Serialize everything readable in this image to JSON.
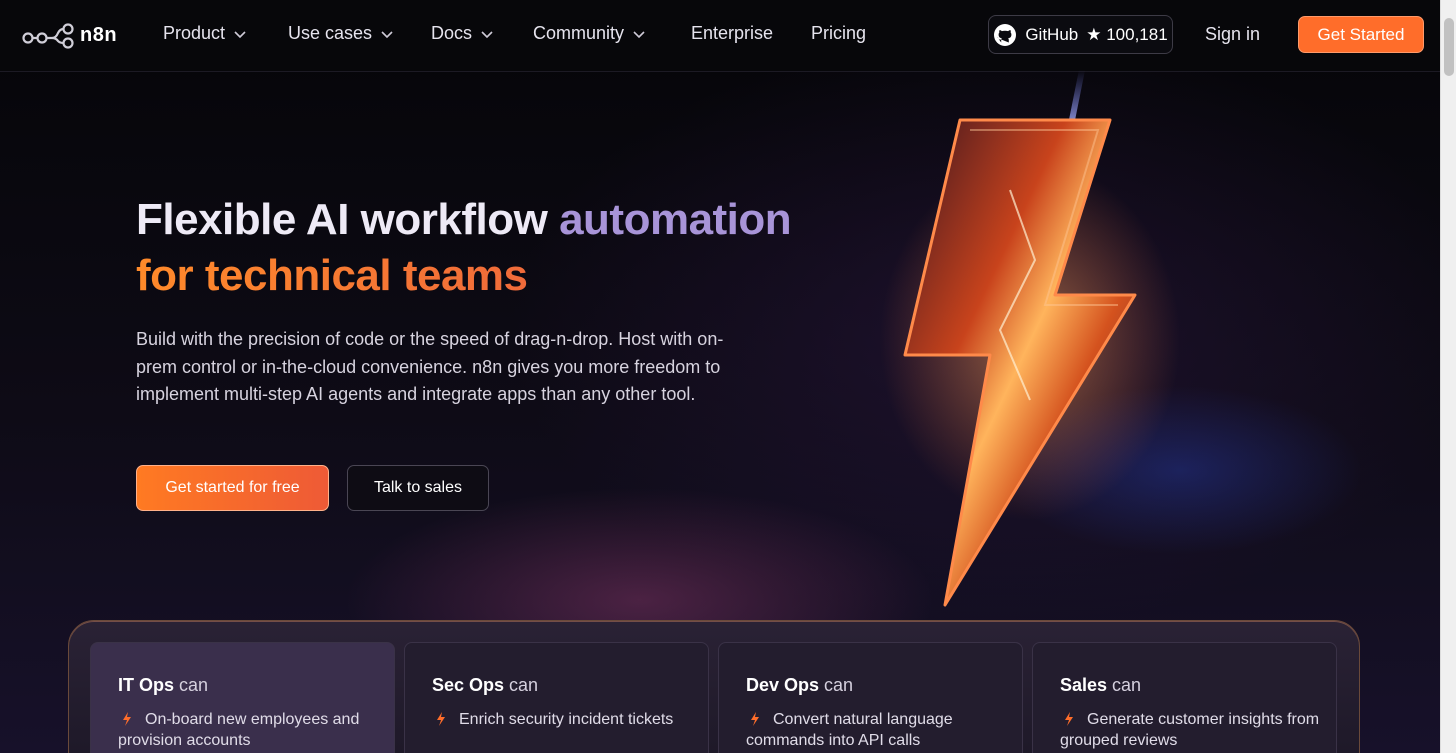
{
  "nav": {
    "logo_text": "n8n",
    "items": [
      {
        "label": "Product",
        "has_dropdown": true
      },
      {
        "label": "Use cases",
        "has_dropdown": true
      },
      {
        "label": "Docs",
        "has_dropdown": true
      },
      {
        "label": "Community",
        "has_dropdown": true
      },
      {
        "label": "Enterprise",
        "has_dropdown": false
      },
      {
        "label": "Pricing",
        "has_dropdown": false
      }
    ],
    "github_label": "GitHub",
    "github_stars": "★ 100,181",
    "signin_label": "Sign in",
    "get_started_label": "Get Started"
  },
  "hero": {
    "headline_part1": "Flexible AI workflow ",
    "headline_part2": "automation",
    "headline_line2": "for technical teams",
    "subtitle": "Build with the precision of code or the speed of drag-n-drop. Host with on-prem control or in-the-cloud convenience. n8n gives you more freedom to implement multi-step AI agents and integrate apps than any other tool.",
    "cta_primary": "Get started for free",
    "cta_secondary": "Talk to sales"
  },
  "cards": [
    {
      "team": "IT Ops",
      "can": " can",
      "item": "On-board new employees and provision accounts"
    },
    {
      "team": "Sec Ops",
      "can": " can",
      "item": "Enrich security incident tickets"
    },
    {
      "team": "Dev Ops",
      "can": " can",
      "item": "Convert natural language commands into API calls"
    },
    {
      "team": "Sales",
      "can": " can",
      "item": "Generate customer insights from grouped reviews"
    }
  ],
  "colors": {
    "accent_orange": "#ff6d2a",
    "headline_purple": "#a894d8",
    "background": "#0d0b14"
  }
}
